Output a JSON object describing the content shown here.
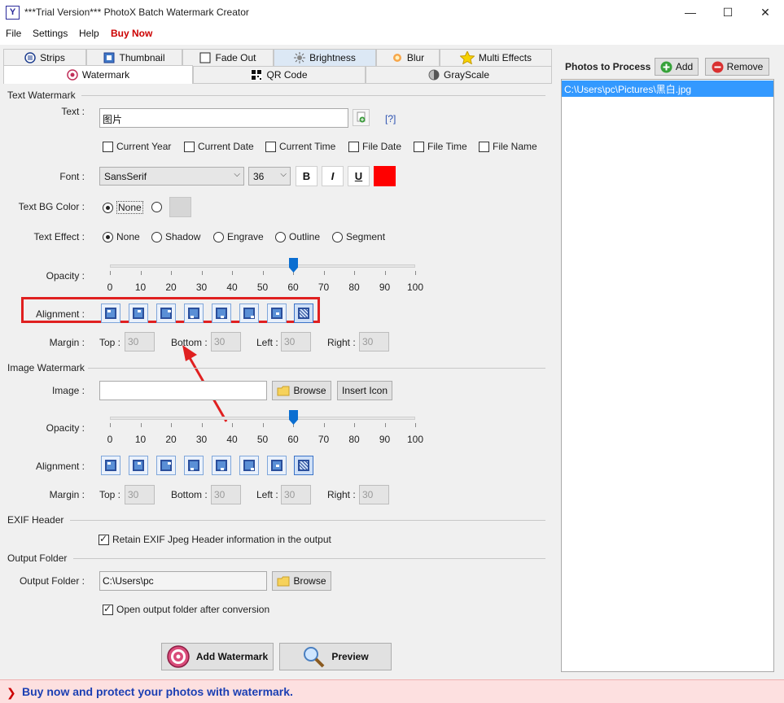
{
  "window": {
    "title": "***Trial Version*** PhotoX Batch Watermark Creator",
    "app_icon": "Y",
    "minimize": "—",
    "maximize": "☐",
    "close": "✕"
  },
  "menu": {
    "file": "File",
    "settings": "Settings",
    "help": "Help",
    "buy": "Buy Now"
  },
  "tabs": {
    "strips": "Strips",
    "thumbnail": "Thumbnail",
    "fade_out": "Fade Out",
    "brightness": "Brightness",
    "blur": "Blur",
    "multi_effects": "Multi Effects",
    "watermark": "Watermark",
    "qr_code": "QR Code",
    "grayscale": "GrayScale"
  },
  "text_watermark": {
    "section": "Text Watermark",
    "text_label": "Text :",
    "text_value": "图片",
    "help_link": "[?]",
    "checks": {
      "current_year": "Current Year",
      "current_date": "Current Date",
      "current_time": "Current Time",
      "file_date": "File Date",
      "file_time": "File Time",
      "file_name": "File Name"
    },
    "font_label": "Font :",
    "font_value": "SansSerif",
    "size_value": "36",
    "bold": "B",
    "italic": "I",
    "underline": "U",
    "font_color": "#ff0000",
    "bg_label": "Text BG Color :",
    "bg_none": "None",
    "effect_label": "Text Effect :",
    "effects": {
      "none": "None",
      "shadow": "Shadow",
      "engrave": "Engrave",
      "outline": "Outline",
      "segment": "Segment"
    },
    "opacity_label": "Opacity :",
    "opacity_value": 60,
    "alignment_label": "Alignment :",
    "margin_label": "Margin :",
    "top_label": "Top :",
    "bottom_label": "Bottom :",
    "left_label": "Left :",
    "right_label": "Right :",
    "top": "30",
    "bottom": "30",
    "left": "30",
    "right": "30"
  },
  "scale": [
    "0",
    "10",
    "20",
    "30",
    "40",
    "50",
    "60",
    "70",
    "80",
    "90",
    "100"
  ],
  "image_watermark": {
    "section": "Image Watermark",
    "image_label": "Image :",
    "image_value": "",
    "browse": "Browse",
    "insert_icon": "Insert Icon",
    "opacity_label": "Opacity :",
    "opacity_value": 60,
    "alignment_label": "Alignment :",
    "margin_label": "Margin :",
    "top_label": "Top :",
    "bottom_label": "Bottom :",
    "left_label": "Left :",
    "right_label": "Right :",
    "top": "30",
    "bottom": "30",
    "left": "30",
    "right": "30"
  },
  "exif": {
    "section": "EXIF Header",
    "retain": "Retain EXIF Jpeg Header information in the output"
  },
  "output": {
    "section": "Output Folder",
    "label": "Output Folder :",
    "value": "C:\\Users\\pc",
    "browse": "Browse",
    "open_after": "Open output folder after conversion"
  },
  "actions": {
    "add_watermark": "Add Watermark",
    "preview": "Preview"
  },
  "photos": {
    "title": "Photos to Process",
    "add": "Add",
    "remove": "Remove",
    "items": [
      "C:\\Users\\pc\\Pictures\\黑白.jpg"
    ]
  },
  "status": {
    "message": "Buy now and protect your photos with watermark."
  },
  "colors": {
    "accent": "#3399ff",
    "highlight_box": "#e02020",
    "buy": "#cc0000",
    "status_text": "#1b3fb3"
  }
}
